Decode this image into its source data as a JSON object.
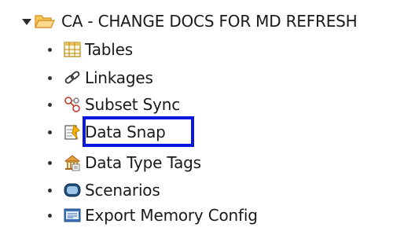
{
  "tree": {
    "root": {
      "label": "CA - CHANGE DOCS FOR MD REFRESH",
      "expanded": true,
      "icon": "folder-open-icon"
    },
    "items": [
      {
        "label": "Tables",
        "icon": "table-icon"
      },
      {
        "label": "Linkages",
        "icon": "link-icon"
      },
      {
        "label": "Subset Sync",
        "icon": "subset-sync-icon"
      },
      {
        "label": "Data Snap",
        "icon": "data-snap-icon",
        "highlighted": true
      },
      {
        "label": "Data Type Tags",
        "icon": "data-type-tags-icon"
      },
      {
        "label": "Scenarios",
        "icon": "scenarios-icon"
      },
      {
        "label": "Export Memory Config",
        "icon": "export-memory-config-icon"
      }
    ]
  },
  "colors": {
    "highlight_border": "#0a17e0",
    "folder": "#f5a623"
  }
}
